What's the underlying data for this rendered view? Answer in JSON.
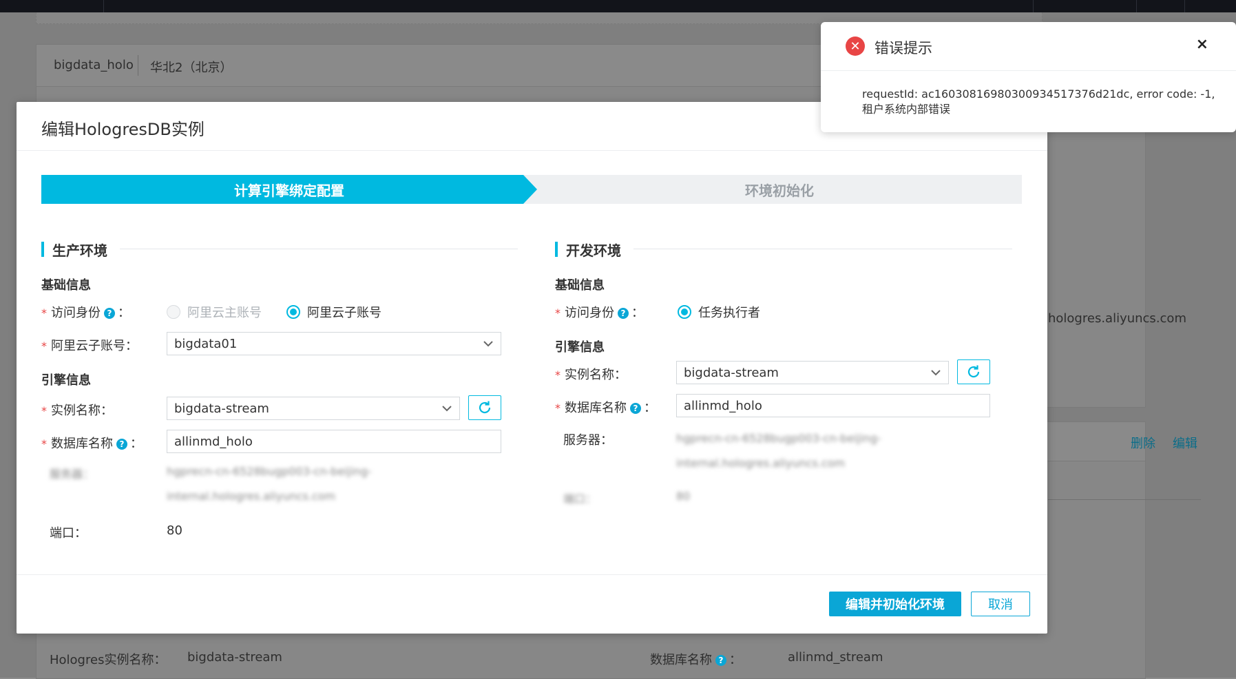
{
  "background": {
    "header_name": "bigdata_holo",
    "header_region": "华北2（北京）",
    "right_text": "hologres.aliyuncs.com",
    "links": [
      "删除",
      "编辑"
    ],
    "bottom_fields": [
      {
        "label": "Hologres实例名称：",
        "value": "bigdata-stream"
      },
      {
        "label": "数据库名称",
        "value": "allinmd_stream"
      }
    ]
  },
  "modal": {
    "title": "编辑HologresDB实例",
    "steps": [
      "计算引擎绑定配置",
      "环境初始化"
    ],
    "production": {
      "title": "生产环境",
      "basic_title": "基础信息",
      "identity_label": "访问身份",
      "identity_options": [
        {
          "label": "阿里云主账号",
          "state": "disabled"
        },
        {
          "label": "阿里云子账号",
          "state": "selected"
        }
      ],
      "subaccount_label": "阿里云子账号：",
      "subaccount_value": "bigdata01",
      "engine_title": "引擎信息",
      "instance_label": "实例名称：",
      "instance_value": "bigdata-stream",
      "db_label": "数据库名称",
      "db_value": "allinmd_holo",
      "server_label_blurred": "服务器：",
      "server_line1_blurred": "hgprecn-cn-6528bugp003-cn-beijing-",
      "server_line2_blurred": "internal.hologres.aliyuncs.com",
      "port_label": "端口：",
      "port_value": "80"
    },
    "development": {
      "title": "开发环境",
      "basic_title": "基础信息",
      "identity_label": "访问身份",
      "identity_option": "任务执行者",
      "engine_title": "引擎信息",
      "instance_label": "实例名称：",
      "instance_value": "bigdata-stream",
      "db_label": "数据库名称",
      "db_value": "allinmd_holo",
      "server_label": "服务器：",
      "server_line1_blurred": "hgprecn-cn-6528bugp003-cn-beijing-",
      "server_line2_blurred": "internal.hologres.aliyuncs.com",
      "port_label_blurred": "端口：",
      "port_value_blurred": "80"
    },
    "buttons": {
      "primary": "编辑并初始化环境",
      "cancel": "取消"
    }
  },
  "toast": {
    "title": "错误提示",
    "message": "requestId: ac16030816980300934517376d21dc, error code: -1, 租户系统内部错误",
    "close": "×"
  },
  "colors": {
    "accent": "#00b9e0",
    "button": "#0aa6d6",
    "error": "#e84545"
  }
}
